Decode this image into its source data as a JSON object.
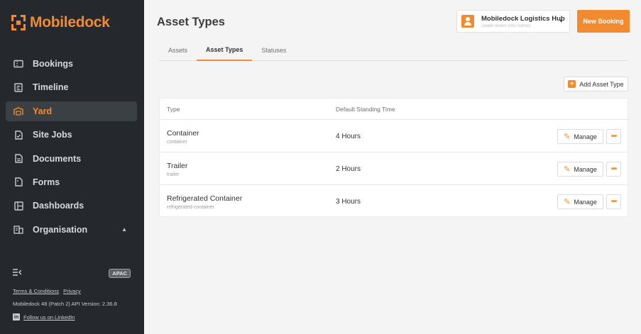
{
  "brand": {
    "name": "Mobiledock",
    "accent": "#f28b30"
  },
  "sidebar": {
    "items": [
      {
        "label": "Bookings",
        "icon": "ticket-icon"
      },
      {
        "label": "Timeline",
        "icon": "timeline-icon"
      },
      {
        "label": "Yard",
        "icon": "warehouse-icon",
        "active": true
      },
      {
        "label": "Site Jobs",
        "icon": "clipboard-check-icon"
      },
      {
        "label": "Documents",
        "icon": "document-icon"
      },
      {
        "label": "Forms",
        "icon": "form-icon"
      },
      {
        "label": "Dashboards",
        "icon": "dashboard-icon"
      },
      {
        "label": "Organisation",
        "icon": "building-icon"
      }
    ],
    "region": "APAC",
    "terms": "Terms & Conditions",
    "privacy": "Privacy",
    "version": "Mobiledock 48 (Patch 2)  API Version: 2.36.8",
    "linkedin": "Follow us on LinkedIn"
  },
  "header": {
    "title": "Asset Types",
    "org_name": "Mobiledock Logistics Hub",
    "org_sub": "Dealer Board (HID Admin)",
    "new_booking": "New Booking"
  },
  "tabs": [
    {
      "label": "Assets"
    },
    {
      "label": "Asset Types",
      "active": true
    },
    {
      "label": "Statuses"
    }
  ],
  "toolbar": {
    "add_label": "Add Asset Type"
  },
  "table": {
    "headers": {
      "type": "Type",
      "time": "Default Standing Time"
    },
    "rows": [
      {
        "name": "Container",
        "slug": "container",
        "time": "4 Hours"
      },
      {
        "name": "Trailer",
        "slug": "trailer",
        "time": "2 Hours"
      },
      {
        "name": "Refrigerated Container",
        "slug": "refrigerated-container",
        "time": "3 Hours"
      }
    ],
    "manage_label": "Manage",
    "more_label": "•••"
  }
}
